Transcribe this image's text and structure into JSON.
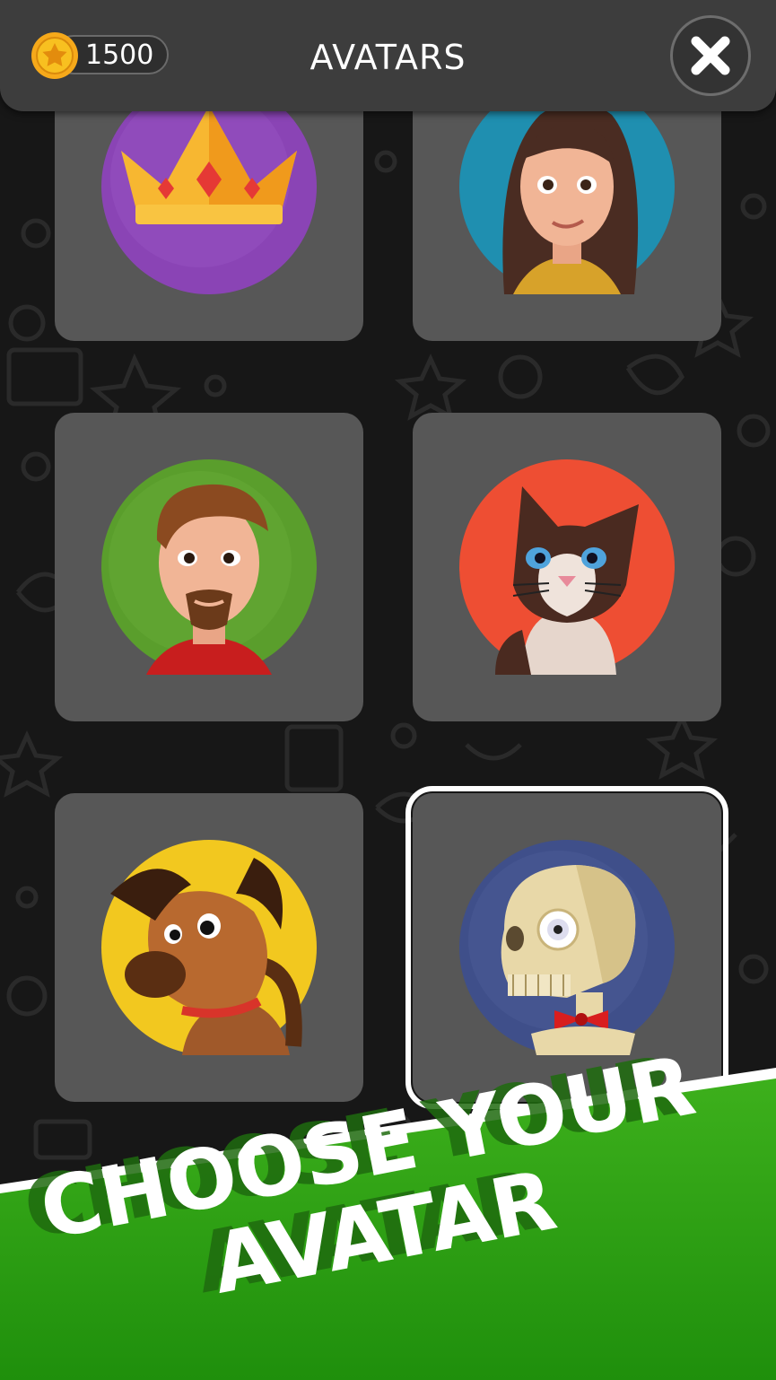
{
  "header": {
    "coins": "1500",
    "title": "AVATARS",
    "close_icon": "close-icon",
    "coin_icon": "star-coin-icon"
  },
  "avatars": [
    {
      "name": "crown",
      "bg": "#8a44b5",
      "selected": false
    },
    {
      "name": "girl",
      "bg": "#1f8fb0",
      "selected": false
    },
    {
      "name": "man",
      "bg": "#5a9e2c",
      "selected": false
    },
    {
      "name": "cat",
      "bg": "#ee4e33",
      "selected": false
    },
    {
      "name": "dog",
      "bg": "#f2c81f",
      "selected": false
    },
    {
      "name": "skeleton",
      "bg": "#3f4f8a",
      "selected": true
    }
  ],
  "banner": {
    "line1": "CHOOSE YOUR",
    "line2": "AVATAR",
    "color": "#2f9d14"
  }
}
